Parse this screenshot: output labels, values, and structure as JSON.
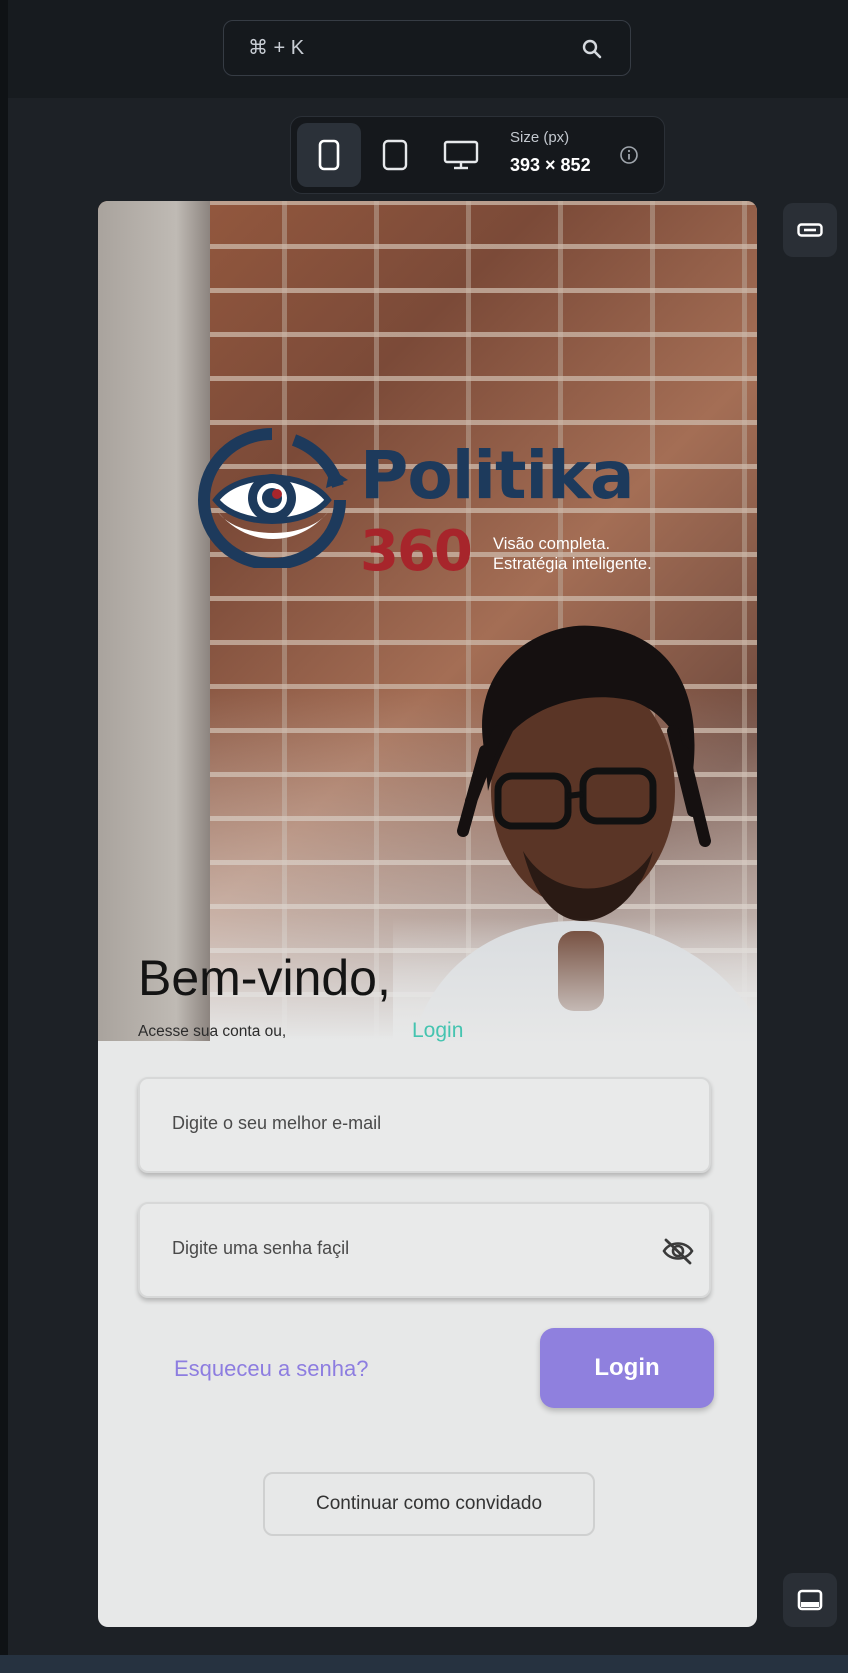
{
  "toolbar": {
    "search_shortcut": "⌘ + K",
    "size_label": "Size (px)",
    "size_value": "393 × 852",
    "devices": [
      "mobile-icon",
      "tablet-icon",
      "desktop-icon"
    ]
  },
  "app": {
    "brand_name": "Politika",
    "brand_number": "360",
    "tagline_line1": "Visão completa.",
    "tagline_line2": "Estratégia inteligente.",
    "welcome_title": "Bem-vindo,",
    "welcome_sub": "Acesse sua conta ou,",
    "login_link": "Login",
    "email_placeholder": "Digite o seu melhor e-mail",
    "password_placeholder": "Digite uma senha façil",
    "forgot_password": "Esqueceu a senha?",
    "login_button": "Login",
    "guest_button": "Continuar como convidado"
  },
  "colors": {
    "accent_purple": "#8f80de",
    "link_teal": "#45c4b0",
    "brand_navy": "#1d3a5c",
    "brand_red": "#a7252b"
  }
}
